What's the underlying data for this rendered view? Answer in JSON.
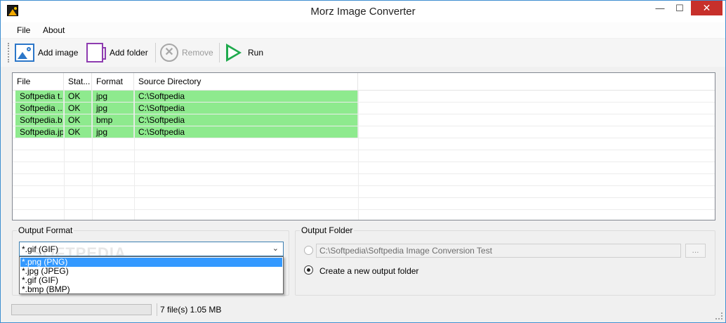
{
  "window": {
    "title": "Morz Image Converter",
    "min_glyph": "—",
    "max_glyph": "☐",
    "close_glyph": "✕"
  },
  "menu": {
    "file": "File",
    "about": "About"
  },
  "toolbar": {
    "add_image": "Add image",
    "add_folder": "Add folder",
    "remove": "Remove",
    "run": "Run"
  },
  "filelist": {
    "headers": {
      "file": "File",
      "status": "Stat...",
      "format": "Format",
      "source": "Source Directory"
    },
    "rows": [
      {
        "file": "Softpedia t...",
        "status": "OK",
        "format": "jpg",
        "source": "C:\\Softpedia"
      },
      {
        "file": "Softpedia ...",
        "status": "OK",
        "format": "jpg",
        "source": "C:\\Softpedia"
      },
      {
        "file": "Softpedia.b...",
        "status": "OK",
        "format": "bmp",
        "source": "C:\\Softpedia"
      },
      {
        "file": "Softpedia.jpg",
        "status": "OK",
        "format": "jpg",
        "source": "C:\\Softpedia"
      }
    ],
    "row_color": "#8eea8e"
  },
  "output_format": {
    "label": "Output Format",
    "selected": "*.gif (GIF)",
    "options": [
      "*.png (PNG)",
      "*.jpg (JPEG)",
      "*.gif (GIF)",
      "*.bmp (BMP)"
    ],
    "highlighted_option": "*.png (PNG)"
  },
  "output_folder": {
    "label": "Output Folder",
    "path": "C:\\Softpedia\\Softpedia Image Conversion Test",
    "browse_label": "...",
    "create_new_label": "Create a new output folder"
  },
  "status": {
    "files_info": "7 file(s)  1.05 MB",
    "progress": 0
  },
  "watermark": "SOFTPEDIA"
}
